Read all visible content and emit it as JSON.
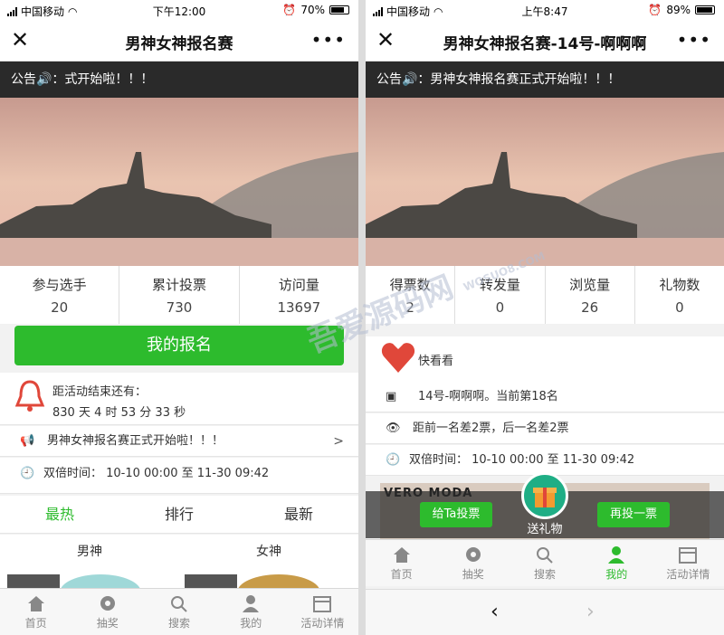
{
  "left": {
    "status": {
      "carrier": "中国移动",
      "time": "下午12:00",
      "battery": "70%",
      "battery_level": 0.7
    },
    "title": "男神女神报名赛",
    "notice": "公告🔊：式开始啦！！！",
    "stats": [
      {
        "label": "参与选手",
        "value": "20"
      },
      {
        "label": "累计投票",
        "value": "730"
      },
      {
        "label": "访问量",
        "value": "13697"
      }
    ],
    "signup_label": "我的报名",
    "countdown": {
      "label": "距活动结束还有：",
      "value": "830 天 4 时 53 分 33 秒"
    },
    "announce": {
      "text": "男神女神报名赛正式开始啦！！！",
      "arrow": ">"
    },
    "double_time": "双倍时间：  10-10 00:00 至 11-30 09:42",
    "tabs": [
      "最热",
      "排行",
      "最新"
    ],
    "genders": [
      "男神",
      "女神"
    ],
    "nav": [
      "首页",
      "抽奖",
      "搜索",
      "我的",
      "活动详情"
    ]
  },
  "right": {
    "status": {
      "carrier": "中国移动",
      "time": "上午8:47",
      "battery": "89%",
      "battery_level": 0.89
    },
    "title": "男神女神报名赛-14号-啊啊啊",
    "notice": "公告🔊：男神女神报名赛正式开始啦！！！",
    "stats": [
      {
        "label": "得票数",
        "value": "2"
      },
      {
        "label": "转发量",
        "value": "0"
      },
      {
        "label": "浏览量",
        "value": "26"
      },
      {
        "label": "礼物数",
        "value": "0"
      }
    ],
    "heart_text": "快看看",
    "rank_text": "14号-啊啊啊。当前第18名",
    "gap_text": "距前一名差2票，后一名差2票",
    "double_time": "双倍时间：  10-10 00:00 至 11-30 09:42",
    "brand_text": "VERO MODA",
    "vote_label": "给Ta投票",
    "gift_label": "送礼物",
    "revote_label": "再投一票",
    "nav": [
      "首页",
      "抽奖",
      "搜索",
      "我的",
      "活动详情"
    ],
    "nav_back": "‹",
    "nav_forward": "›"
  },
  "watermark": {
    "text": "吾爱源码网",
    "sub": "WOSUO8.COM"
  },
  "colors": {
    "accent": "#2dbb2d",
    "notice_bg": "#2a2a2a",
    "bell": "#e0473a"
  }
}
